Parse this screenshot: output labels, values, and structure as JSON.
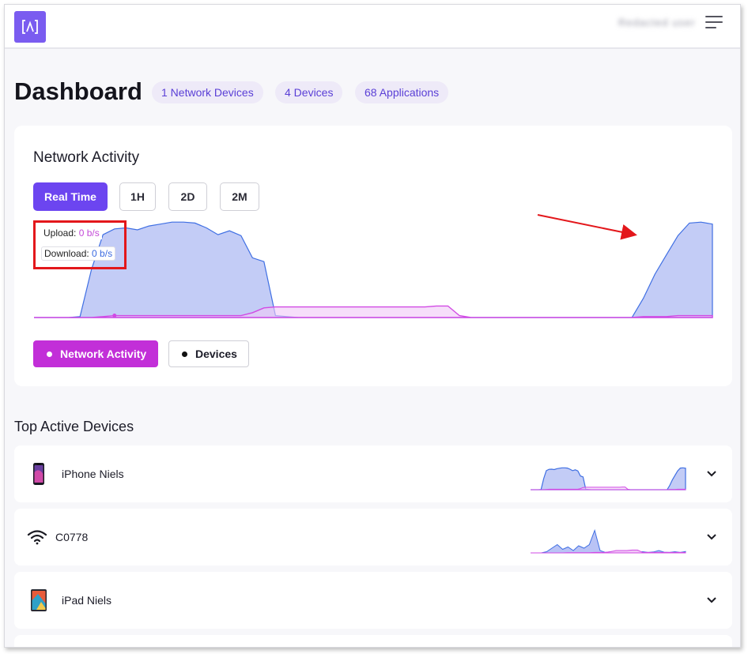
{
  "header": {
    "logo_glyph": "[/\\]",
    "username": "Redacted user",
    "menu_icon": "hamburger-menu-icon"
  },
  "page": {
    "title": "Dashboard",
    "pills": [
      {
        "label": "1 Network Devices"
      },
      {
        "label": "4 Devices"
      },
      {
        "label": "68 Applications"
      }
    ]
  },
  "network_card": {
    "title": "Network Activity",
    "ranges": [
      {
        "label": "Real Time",
        "active": true
      },
      {
        "label": "1H",
        "active": false
      },
      {
        "label": "2D",
        "active": false
      },
      {
        "label": "2M",
        "active": false
      }
    ],
    "tooltip": {
      "upload_label": "Upload:",
      "upload_value": "0 b/s",
      "download_label": "Download:",
      "download_value": "0 b/s"
    },
    "legend": {
      "network_activity": "Network Activity",
      "devices": "Devices"
    }
  },
  "colors": {
    "accent": "#6c45f0",
    "legend_active": "#c22fd8",
    "download_fill": "#b9c3f5",
    "download_line": "#3f6fe3",
    "upload_line": "#d14ae4",
    "annotation_red": "#e3171b"
  },
  "top_devices": {
    "title": "Top Active Devices",
    "items": [
      {
        "name": "iPhone Niels",
        "icon": "iphone-icon"
      },
      {
        "name": "C0778",
        "icon": "wifi-icon"
      },
      {
        "name": "iPad Niels",
        "icon": "ipad-icon"
      }
    ]
  },
  "chart_data": {
    "type": "area",
    "title": "",
    "xlabel": "",
    "ylabel": "",
    "x": [
      0,
      1,
      2,
      3,
      4,
      5,
      6,
      7,
      8,
      9,
      10,
      11,
      12,
      13,
      14,
      15,
      16,
      17,
      18,
      19,
      20,
      21,
      22,
      23,
      24,
      25,
      26,
      27,
      28,
      29,
      30,
      31,
      32,
      33,
      34,
      35,
      36,
      37,
      38,
      39,
      40,
      41,
      42,
      43,
      44,
      45,
      46,
      47,
      48,
      49,
      50,
      51,
      52,
      53,
      54,
      55,
      56,
      57,
      58,
      59
    ],
    "series": [
      {
        "values": [
          0,
          0,
          0,
          0,
          0.01,
          0.5,
          0.86,
          0.92,
          0.93,
          0.91,
          0.95,
          0.97,
          0.99,
          0.99,
          0.98,
          0.93,
          0.86,
          0.9,
          0.85,
          0.62,
          0.58,
          0.02,
          0.01,
          0,
          0,
          0,
          0,
          0,
          0,
          0,
          0,
          0,
          0,
          0,
          0,
          0,
          0,
          0,
          0,
          0,
          0,
          0,
          0,
          0,
          0,
          0,
          0,
          0,
          0,
          0,
          0,
          0,
          0,
          0.2,
          0.45,
          0.65,
          0.85,
          0.98,
          0.99,
          0.97
        ]
      },
      {
        "values": [
          0,
          0,
          0,
          0,
          0,
          0,
          0.01,
          0.02,
          0.02,
          0.02,
          0.02,
          0.02,
          0.02,
          0.02,
          0.02,
          0.02,
          0.02,
          0.02,
          0.02,
          0.05,
          0.1,
          0.11,
          0.11,
          0.11,
          0.11,
          0.11,
          0.11,
          0.11,
          0.11,
          0.11,
          0.11,
          0.11,
          0.11,
          0.11,
          0.11,
          0.12,
          0.12,
          0.02,
          0,
          0,
          0,
          0,
          0,
          0,
          0,
          0,
          0,
          0,
          0,
          0,
          0,
          0,
          0,
          0.01,
          0.01,
          0.01,
          0.02,
          0.02,
          0.02,
          0.02
        ]
      }
    ]
  }
}
